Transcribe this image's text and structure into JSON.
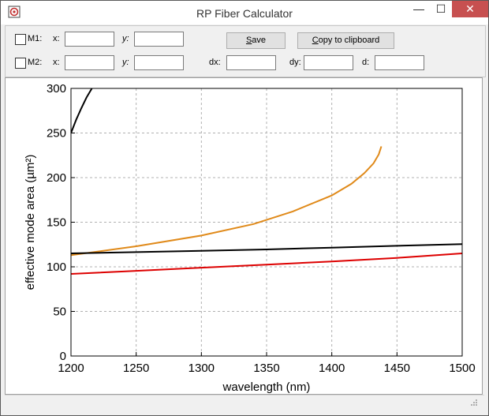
{
  "window": {
    "title": "RP Fiber Calculator",
    "minimize_glyph": "—",
    "maximize_glyph": "☐",
    "close_glyph": "✕"
  },
  "toolbar": {
    "m1": {
      "label": "M1:",
      "x_label": "x:",
      "y_label": "y:",
      "x_value": "",
      "y_value": ""
    },
    "m2": {
      "label": "M2:",
      "x_label": "x:",
      "y_label": "y:",
      "x_value": "",
      "y_value": ""
    },
    "dx_label": "dx:",
    "dy_label": "dy:",
    "d_label": "d:",
    "dx_value": "",
    "dy_value": "",
    "d_value": "",
    "save_label_u": "S",
    "save_label_rest": "ave",
    "copy_label_u": "C",
    "copy_label_rest": "opy to clipboard"
  },
  "chart_data": {
    "type": "line",
    "xlabel": "wavelength (nm)",
    "ylabel": "effective mode area (µm²)",
    "xlim": [
      1200,
      1500
    ],
    "ylim": [
      0,
      300
    ],
    "x_ticks": [
      1200,
      1250,
      1300,
      1350,
      1400,
      1450,
      1500
    ],
    "y_ticks": [
      0,
      50,
      100,
      150,
      200,
      250,
      300
    ],
    "grid": true,
    "series": [
      {
        "color": "#000000",
        "x": [
          1200,
          1204,
          1208,
          1212,
          1216,
          1218
        ],
        "y": [
          250,
          265,
          278,
          290,
          300,
          305
        ]
      },
      {
        "color": "#e08a1a",
        "x": [
          1200,
          1250,
          1300,
          1340,
          1370,
          1400,
          1415,
          1425,
          1432,
          1436,
          1438
        ],
        "y": [
          113,
          123,
          135,
          148,
          162,
          180,
          193,
          205,
          216,
          226,
          235
        ]
      },
      {
        "color": "#000000",
        "x": [
          1200,
          1250,
          1300,
          1350,
          1400,
          1450,
          1500
        ],
        "y": [
          115,
          116.5,
          118,
          119.5,
          121.5,
          123.5,
          125.5
        ]
      },
      {
        "color": "#dd0000",
        "x": [
          1200,
          1250,
          1300,
          1350,
          1400,
          1450,
          1500
        ],
        "y": [
          92,
          95.5,
          99,
          102.5,
          106,
          110,
          115
        ]
      }
    ]
  }
}
